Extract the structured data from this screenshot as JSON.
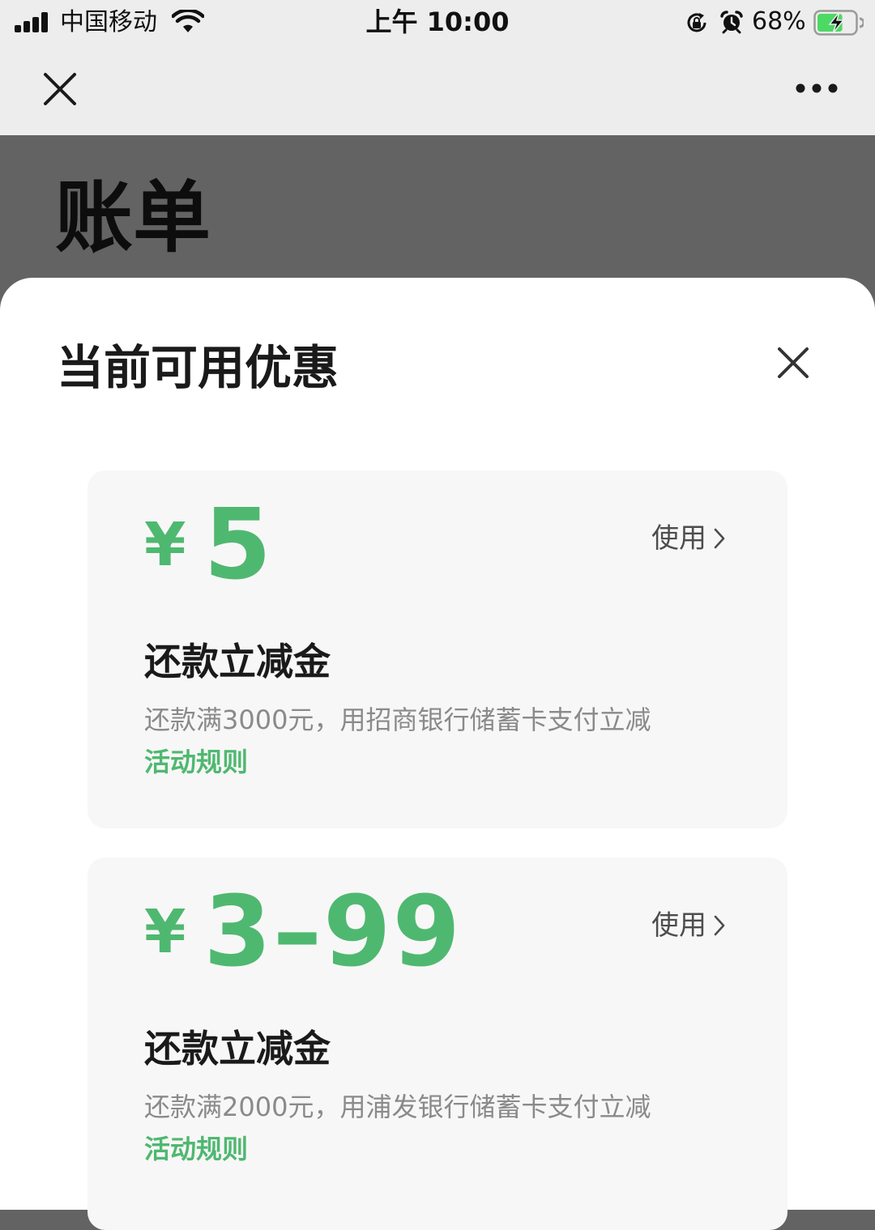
{
  "status_bar": {
    "carrier": "中国移动",
    "time": "上午 10:00",
    "battery_percent": "68%",
    "battery_level": 0.68,
    "icons": [
      "signal-icon",
      "wifi-icon",
      "rotation-lock-icon",
      "alarm-icon",
      "battery-icon"
    ]
  },
  "nav": {
    "left_icon": "close-icon",
    "right_icon": "more-icon"
  },
  "page": {
    "title": "账单"
  },
  "sheet": {
    "title": "当前可用优惠",
    "close_icon": "close-icon",
    "coupons": [
      {
        "currency": "¥",
        "amount": "5",
        "use_label": "使用",
        "name": "还款立减金",
        "description": "还款满3000元，用招商银行储蓄卡支付立减",
        "rules_label": "活动规则"
      },
      {
        "currency": "¥",
        "amount": "3–99",
        "use_label": "使用",
        "name": "还款立减金",
        "description": "还款满2000元，用浦发银行储蓄卡支付立减",
        "rules_label": "活动规则"
      }
    ]
  },
  "colors": {
    "accent_green": "#4fb870",
    "sheet_background": "#ffffff",
    "coupon_background": "#f7f7f7",
    "overlay_background": "#636363",
    "nav_background": "#ededed"
  }
}
